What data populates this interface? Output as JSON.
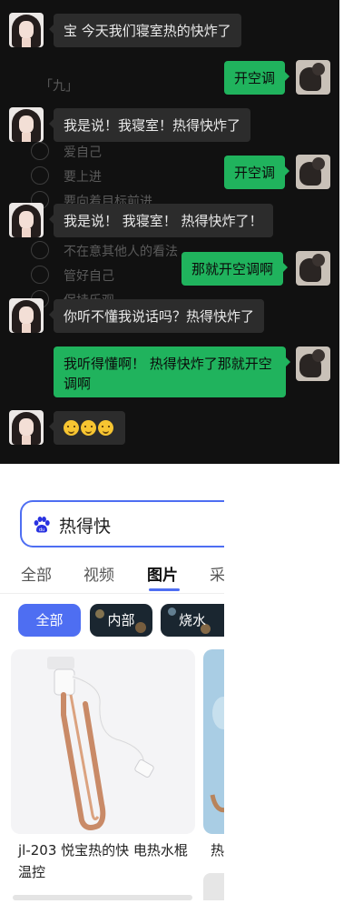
{
  "chat": {
    "background_color": "#111111",
    "bubble_me_color": "#20b35d",
    "bubble_other_color": "#2c2c2c",
    "background_texts": {
      "heading": "「九」",
      "line1": "爱自己",
      "line2": "要上进",
      "line3": "要向着目标前进",
      "line4": "不在意其他人的看法",
      "line5": "管好自己",
      "line6": "保持乐观"
    },
    "messages": [
      {
        "sender": "other",
        "text": "宝 今天我们寝室热的快炸了"
      },
      {
        "sender": "me",
        "text": "开空调"
      },
      {
        "sender": "other",
        "text": "我是说！我寝室！热得快炸了"
      },
      {
        "sender": "me",
        "text": "开空调"
      },
      {
        "sender": "other",
        "text": "我是说！ 我寝室！ 热得快炸了！"
      },
      {
        "sender": "me",
        "text": "那就开空调啊"
      },
      {
        "sender": "other",
        "text": "你听不懂我说话吗？热得快炸了"
      },
      {
        "sender": "me",
        "text": "我听得懂啊！ 热得快炸了那就开空调啊"
      },
      {
        "sender": "other",
        "emoji_count": 3,
        "emoji": "grimacing-face"
      }
    ]
  },
  "search": {
    "logo_icon": "baidu-paw-icon",
    "accent_color": "#4e6ef2",
    "query": "热得快",
    "tabs": [
      {
        "label": "全部",
        "active": false
      },
      {
        "label": "视频",
        "active": false
      },
      {
        "label": "图片",
        "active": true
      },
      {
        "label": "采",
        "active": false
      }
    ],
    "filters": [
      {
        "label": "全部",
        "active": true
      },
      {
        "label": "内部",
        "active": false
      },
      {
        "label": "烧水",
        "active": false
      }
    ],
    "results": [
      {
        "title": "jl-203 悦宝热的快 电热水棍 温控",
        "image": "immersion-heater-coil"
      },
      {
        "title": "热",
        "image": "immersion-heater-blue-bg"
      }
    ]
  }
}
